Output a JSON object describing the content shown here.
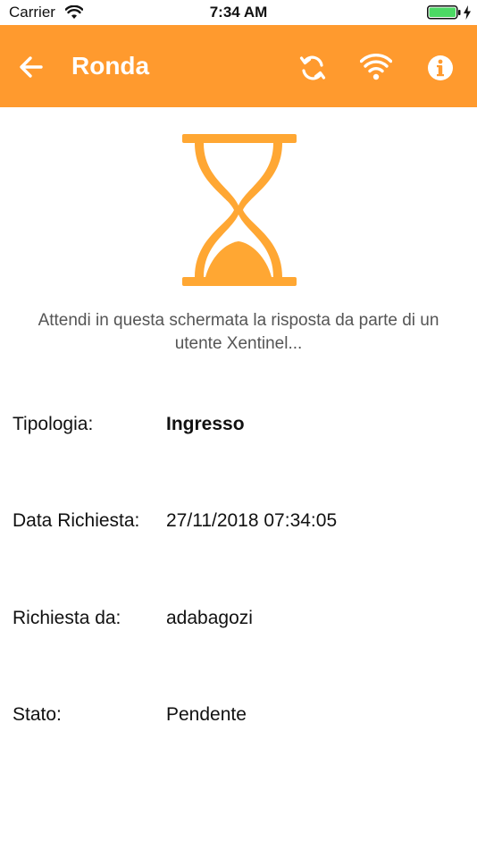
{
  "status_bar": {
    "carrier": "Carrier",
    "time": "7:34 AM",
    "battery_color": "#4CD964"
  },
  "nav": {
    "title": "Ronda",
    "background": "#FF9A2E",
    "icons": [
      "arrow-left-icon",
      "sync-icon",
      "wifi-icon",
      "info-icon"
    ]
  },
  "hourglass": {
    "color": "#FFA733"
  },
  "message": "Attendi in questa schermata la risposta da parte di un utente Xentinel...",
  "details": [
    {
      "label": "Tipologia:",
      "value": "Ingresso"
    },
    {
      "label": "Data Richiesta:",
      "value": "27/11/2018 07:34:05"
    },
    {
      "label": "Richiesta da:",
      "value": "adabagozi"
    },
    {
      "label": "Stato:",
      "value": "Pendente"
    }
  ]
}
